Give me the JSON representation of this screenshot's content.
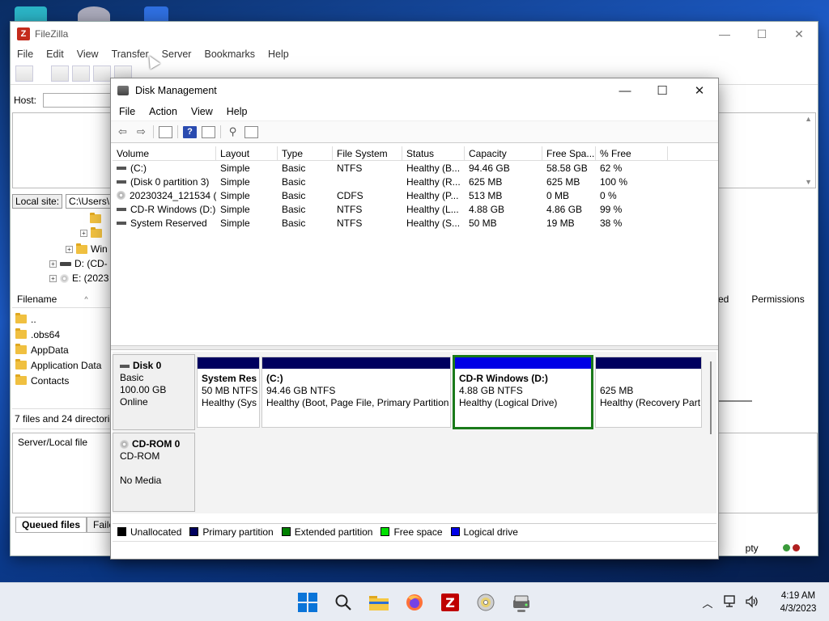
{
  "filezilla": {
    "title": "FileZilla",
    "menu": [
      "File",
      "Edit",
      "View",
      "Transfer",
      "Server",
      "Bookmarks",
      "Help"
    ],
    "host_label": "Host:",
    "local_site_label": "Local site:",
    "local_site_value": "C:\\Users\\",
    "tree": [
      {
        "label": "Win",
        "type": "folder"
      },
      {
        "label": "D: (CD-",
        "type": "drive"
      },
      {
        "label": "E: (2023",
        "type": "disc"
      }
    ],
    "filename_header": "Filename",
    "files": [
      "..",
      ".obs64",
      "AppData",
      "Application Data",
      "Contacts"
    ],
    "remote_headers": [
      "ed",
      "Permissions"
    ],
    "local_status": "7 files and 24 directories",
    "queue_header": "Server/Local file",
    "tabs": [
      "Queued files",
      "Faile"
    ],
    "bottom_status": "pty",
    "status_colors": {
      "green": "#3a9a3a",
      "red": "#b02020"
    }
  },
  "disk_management": {
    "title": "Disk Management",
    "menu": [
      "File",
      "Action",
      "View",
      "Help"
    ],
    "columns": [
      "Volume",
      "Layout",
      "Type",
      "File System",
      "Status",
      "Capacity",
      "Free Spa...",
      "% Free"
    ],
    "volumes": [
      {
        "icon": "drive",
        "volume": "(C:)",
        "layout": "Simple",
        "type": "Basic",
        "fs": "NTFS",
        "status": "Healthy (B...",
        "capacity": "94.46 GB",
        "free": "58.58 GB",
        "pct": "62 %"
      },
      {
        "icon": "drive",
        "volume": "(Disk 0 partition 3)",
        "layout": "Simple",
        "type": "Basic",
        "fs": "",
        "status": "Healthy (R...",
        "capacity": "625 MB",
        "free": "625 MB",
        "pct": "100 %"
      },
      {
        "icon": "cd",
        "volume": "20230324_121534 (...",
        "layout": "Simple",
        "type": "Basic",
        "fs": "CDFS",
        "status": "Healthy (P...",
        "capacity": "513 MB",
        "free": "0 MB",
        "pct": "0 %"
      },
      {
        "icon": "drive",
        "volume": "CD-R Windows (D:)",
        "layout": "Simple",
        "type": "Basic",
        "fs": "NTFS",
        "status": "Healthy (L...",
        "capacity": "4.88 GB",
        "free": "4.86 GB",
        "pct": "99 %"
      },
      {
        "icon": "drive",
        "volume": "System Reserved",
        "layout": "Simple",
        "type": "Basic",
        "fs": "NTFS",
        "status": "Healthy (S...",
        "capacity": "50 MB",
        "free": "19 MB",
        "pct": "38 %"
      }
    ],
    "disk0": {
      "name": "Disk 0",
      "type": "Basic",
      "size": "100.00 GB",
      "state": "Online",
      "partitions": [
        {
          "title": "System Res",
          "size": "50 MB NTFS",
          "status": "Healthy (Sys"
        },
        {
          "title": "(C:)",
          "size": "94.46 GB NTFS",
          "status": "Healthy (Boot, Page File, Primary Partition"
        },
        {
          "title": "CD-R Windows  (D:)",
          "size": "4.88 GB NTFS",
          "status": "Healthy (Logical Drive)"
        },
        {
          "title": "",
          "size": "625 MB",
          "status": "Healthy (Recovery Part"
        }
      ]
    },
    "cdrom0": {
      "name": "CD-ROM 0",
      "type": "CD-ROM",
      "state": "No Media"
    },
    "legend": [
      {
        "label": "Unallocated",
        "color": "#000000"
      },
      {
        "label": "Primary partition",
        "color": "#00005f"
      },
      {
        "label": "Extended partition",
        "color": "#008000"
      },
      {
        "label": "Free space",
        "color": "#00e000"
      },
      {
        "label": "Logical drive",
        "color": "#0000e6"
      }
    ]
  },
  "taskbar": {
    "apps": [
      "windows-start",
      "search",
      "file-explorer",
      "firefox",
      "filezilla",
      "disc-burner",
      "disk-management"
    ],
    "time": "4:19 AM",
    "date": "4/3/2023"
  }
}
